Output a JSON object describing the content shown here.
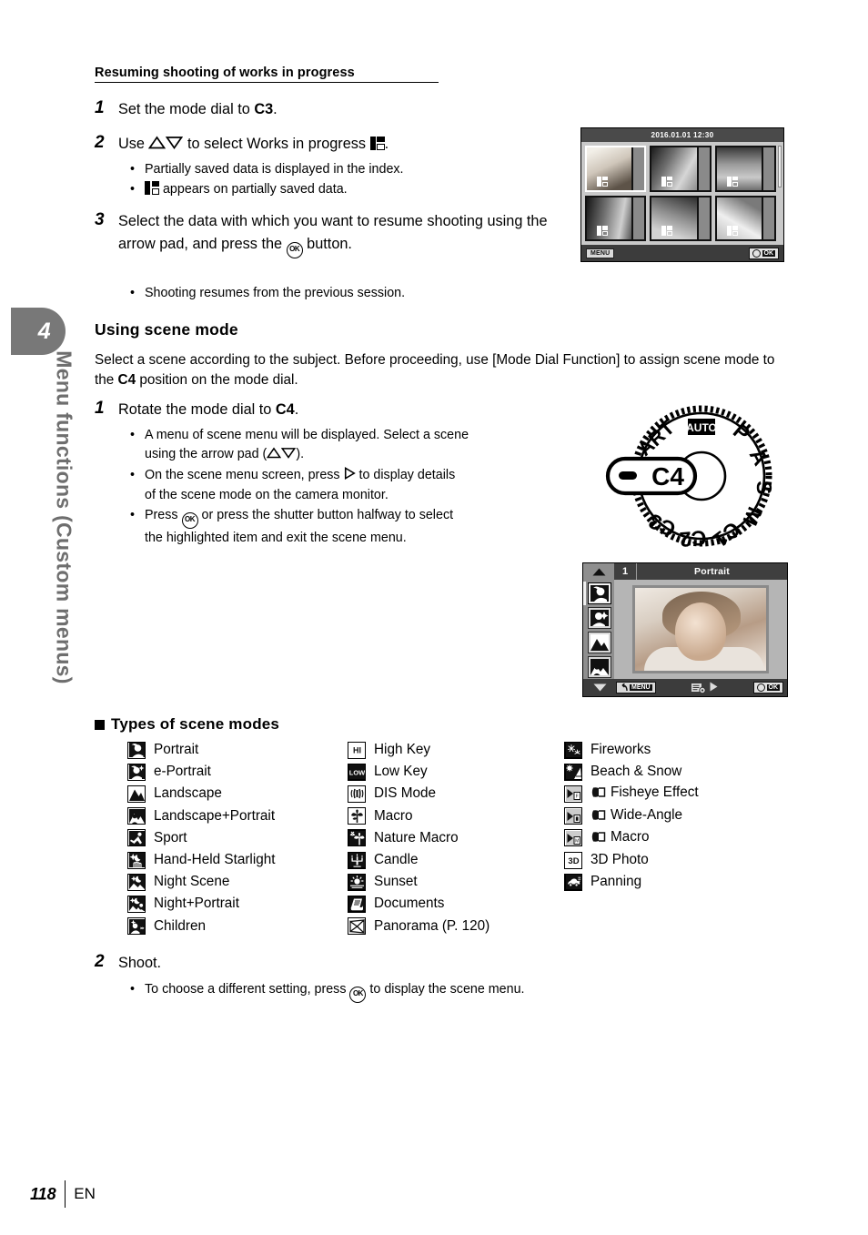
{
  "sidebar": {
    "chapter_number": "4",
    "chapter_title": "Menu functions (Custom menus)"
  },
  "footer": {
    "page_number": "118",
    "language": "EN"
  },
  "section_resuming": {
    "heading": "Resuming shooting of works in progress",
    "steps": [
      {
        "num": "1",
        "text_before": "Set the mode dial to ",
        "bold": "C3",
        "text_after": "."
      },
      {
        "num": "2",
        "text_before": "Use ",
        "text_mid": " to select Works in progress ",
        "text_after": "."
      },
      {
        "num": "3",
        "text_before": "Select the data with which you want to resume shooting using the arrow pad, and press the ",
        "text_after": " button."
      }
    ],
    "bullets_step2": [
      "Partially saved data is displayed in the index.",
      "appears on partially saved data."
    ],
    "bullets_step3": [
      "Shooting resumes from the previous session."
    ]
  },
  "section_scene": {
    "heading": "Using scene mode",
    "intro_1": "Select a scene according to the subject. Before proceeding, use [Mode Dial Function]",
    "intro_2_before": "to assign scene mode to the ",
    "intro_2_bold": "C4",
    "intro_2_after": " position on the mode dial.",
    "step1": {
      "num": "1",
      "text_before": "Rotate the mode dial to ",
      "bold": "C4",
      "text_after": "."
    },
    "step1_bullets": [
      {
        "line1": "A menu of scene menu will be displayed. Select a scene",
        "line2_before": "using the arrow pad (",
        "line2_after": ")."
      },
      {
        "line1_before": "On the scene menu screen, press ",
        "line1_after": " to display details",
        "line2": "of the scene mode on the camera monitor."
      },
      {
        "line1_before": "Press ",
        "line1_after": " or press the shutter button halfway to select",
        "line2": "the highlighted item and exit the scene menu."
      }
    ],
    "step2": {
      "num": "2",
      "text": "Shoot."
    },
    "step2_bullets_before": "To choose a different setting, press ",
    "step2_bullets_after": " to display the scene menu."
  },
  "index_screen": {
    "timestamp": "2016.01.01 12:30",
    "menu_label": "MENU",
    "ok_label": "OK",
    "thumbnail_count": 6,
    "selected_index": 1
  },
  "scene_screen": {
    "page_indicator": "1",
    "title": "Portrait",
    "menu_label": "MENU",
    "ok_label": "OK",
    "rail_icon_count": 4,
    "active_rail_icon": 1
  },
  "mode_dial": {
    "positions": [
      "AUTO",
      "P",
      "A",
      "S",
      "M",
      "C1",
      "C2",
      "C3",
      "ART"
    ],
    "selected": "C4",
    "indicator_label": "C4"
  },
  "types_of_scene_modes": {
    "heading": "Types of scene modes",
    "columns": [
      {
        "items": [
          {
            "icon": "portrait-icon",
            "label": "Portrait"
          },
          {
            "icon": "e-portrait-icon",
            "label": "e-Portrait"
          },
          {
            "icon": "landscape-icon",
            "label": "Landscape"
          },
          {
            "icon": "landscape-portrait-icon",
            "label": "Landscape+Portrait"
          },
          {
            "icon": "sport-icon",
            "label": "Sport"
          },
          {
            "icon": "hand-held-starlight-icon",
            "label": "Hand-Held Starlight"
          },
          {
            "icon": "night-scene-icon",
            "label": "Night Scene"
          },
          {
            "icon": "night-portrait-icon",
            "label": "Night+Portrait"
          },
          {
            "icon": "children-icon",
            "label": "Children"
          }
        ]
      },
      {
        "items": [
          {
            "icon": "high-key-icon",
            "label": "High Key"
          },
          {
            "icon": "low-key-icon",
            "label": "Low Key"
          },
          {
            "icon": "dis-mode-icon",
            "label": "DIS Mode"
          },
          {
            "icon": "macro-icon",
            "label": "Macro"
          },
          {
            "icon": "nature-macro-icon",
            "label": "Nature Macro"
          },
          {
            "icon": "candle-icon",
            "label": "Candle"
          },
          {
            "icon": "sunset-icon",
            "label": "Sunset"
          },
          {
            "icon": "documents-icon",
            "label": "Documents"
          },
          {
            "icon": "panorama-icon",
            "label": "Panorama (P. 120)"
          }
        ]
      },
      {
        "items": [
          {
            "icon": "fireworks-icon",
            "label": "Fireworks"
          },
          {
            "icon": "beach-snow-icon",
            "label": "Beach & Snow"
          },
          {
            "icon": "fisheye-effect-icon",
            "label": "Fisheye Effect",
            "lens": true
          },
          {
            "icon": "wide-angle-icon",
            "label": "Wide-Angle",
            "lens": true
          },
          {
            "icon": "converter-macro-icon",
            "label": "Macro",
            "lens": true
          },
          {
            "icon": "3d-photo-icon",
            "label": "3D Photo"
          },
          {
            "icon": "panning-icon",
            "label": "Panning"
          }
        ]
      }
    ]
  }
}
